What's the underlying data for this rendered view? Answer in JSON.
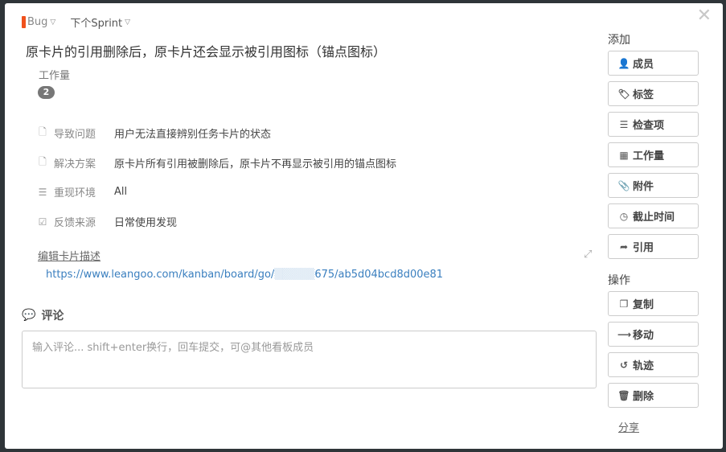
{
  "card": {
    "type": "Bug",
    "type_color": "#f0521d",
    "sprint": "下个Sprint",
    "title": "原卡片的引用删除后，原卡片还会显示被引用图标（锚点图标）",
    "close_label": "✕",
    "workload_label": "工作量",
    "workload_value": "2"
  },
  "fields": [
    {
      "icon": "document-icon",
      "glyph": "🗋",
      "name": "导致问题",
      "value": "用户无法直接辨别任务卡片的状态"
    },
    {
      "icon": "document-icon",
      "glyph": "🗋",
      "name": "解决方案",
      "value": "原卡片所有引用被删除后，原卡片不再显示被引用的锚点图标"
    },
    {
      "icon": "checklist-icon",
      "glyph": "☰",
      "name": "重现环境",
      "value": "All"
    },
    {
      "icon": "checkbox-icon",
      "glyph": "☑",
      "name": "反馈来源",
      "value": "日常使用发现"
    }
  ],
  "description": {
    "edit_label": "编辑卡片描述",
    "link_prefix": "https://www.leangoo.com/kanban/board/go/",
    "link_masked": "▒▒▒▒▒",
    "link_suffix": "675/ab5d04bcd8d00e81"
  },
  "comment": {
    "heading": "评论",
    "placeholder": "输入评论... shift+enter换行，回车提交，可@其他看板成员"
  },
  "sidebar": {
    "add_heading": "添加",
    "add_buttons": [
      {
        "name": "member",
        "icon": "user-plus-icon",
        "glyph": "👤",
        "label": "成员"
      },
      {
        "name": "tag",
        "icon": "tag-icon",
        "glyph": "🏷",
        "label": "标签"
      },
      {
        "name": "checklist",
        "icon": "list-icon",
        "glyph": "☰",
        "label": "检查项"
      },
      {
        "name": "workload",
        "icon": "grid-icon",
        "glyph": "▦",
        "label": "工作量"
      },
      {
        "name": "attachment",
        "icon": "paperclip-icon",
        "glyph": "📎",
        "label": "附件"
      },
      {
        "name": "deadline",
        "icon": "clock-icon",
        "glyph": "◷",
        "label": "截止时间"
      },
      {
        "name": "reference",
        "icon": "share-arrow-icon",
        "glyph": "➦",
        "label": "引用"
      }
    ],
    "action_heading": "操作",
    "action_buttons": [
      {
        "name": "copy",
        "icon": "copy-icon",
        "glyph": "❐",
        "label": "复制"
      },
      {
        "name": "move",
        "icon": "arrow-right-icon",
        "glyph": "⟶",
        "label": "移动"
      },
      {
        "name": "history",
        "icon": "history-icon",
        "glyph": "↺",
        "label": "轨迹"
      },
      {
        "name": "delete",
        "icon": "trash-icon",
        "glyph": "🗑",
        "label": "删除"
      }
    ],
    "share_label": "分享"
  }
}
